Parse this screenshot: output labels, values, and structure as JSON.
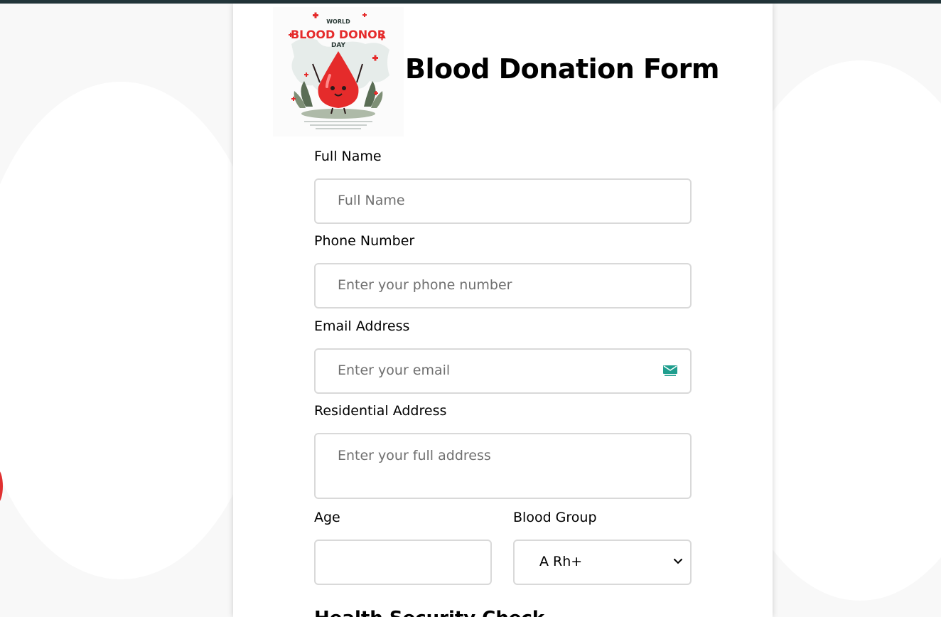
{
  "form": {
    "title": "Blood Donation Form",
    "logo_text": {
      "line1": "WORLD",
      "line2": "BLOOD DONOR",
      "line3": "DAY"
    },
    "fields": {
      "full_name": {
        "label": "Full Name",
        "placeholder": "Full Name"
      },
      "phone": {
        "label": "Phone Number",
        "placeholder": "Enter your phone number"
      },
      "email": {
        "label": "Email Address",
        "placeholder": "Enter your email"
      },
      "address": {
        "label": "Residential Address",
        "placeholder": "Enter your full address"
      },
      "age": {
        "label": "Age",
        "value": ""
      },
      "blood_group": {
        "label": "Blood Group",
        "selected": "A Rh+"
      }
    },
    "next_section_heading": "Health Security Check"
  },
  "icons": {
    "email_field_icon": "envelope-icon",
    "select_icon": "chevron-down-icon"
  },
  "colors": {
    "topbar": "#22353a",
    "accent_red": "#e52b2b",
    "field_border": "#d9d9d9"
  }
}
